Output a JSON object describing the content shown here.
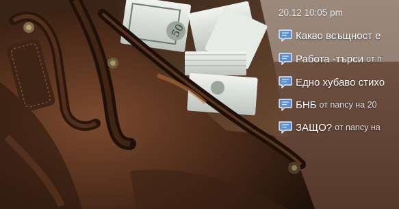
{
  "feed": {
    "timestamp": "20.12 10:05 pm",
    "items": [
      {
        "title": "Какво всъщност е",
        "meta": ""
      },
      {
        "title": "Работа -търси",
        "meta": "от n"
      },
      {
        "title": "Едно хубаво стихо",
        "meta": ""
      },
      {
        "title": "БНБ",
        "meta": "от nancy на 20"
      },
      {
        "title": "ЗАЩО?",
        "meta": "от nancy на"
      }
    ]
  },
  "colors": {
    "bubble_fill": "#5b8fcf",
    "bubble_border": "#e6eef8",
    "leather_dark": "#2d1a0f",
    "leather_mid": "#5a3421",
    "banknote": "#dfe3df"
  },
  "icons": {
    "comment": "speech-bubble-icon"
  }
}
